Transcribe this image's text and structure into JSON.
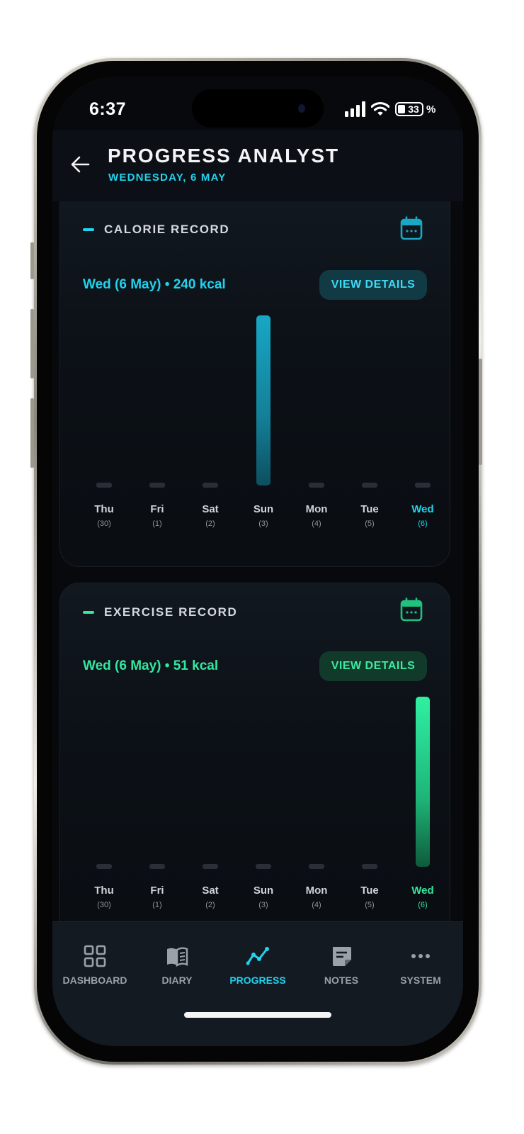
{
  "status": {
    "time": "6:37",
    "battery": "33",
    "battery_pct": "%"
  },
  "header": {
    "title": "PROGRESS ANALYST",
    "subtitle": "WEDNESDAY, 6 MAY"
  },
  "colors": {
    "cyan": "#22d3ee",
    "green": "#34e89e",
    "background": "#07090d"
  },
  "calorie": {
    "title": "CALORIE RECORD",
    "summary": "Wed (6 May) • 240 kcal",
    "button": "VIEW DETAILS",
    "icon": "calendar-icon"
  },
  "exercise": {
    "title": "EXERCISE RECORD",
    "summary": "Wed (6 May) • 51 kcal",
    "button": "VIEW DETAILS",
    "icon": "calendar-icon"
  },
  "chart_data": [
    {
      "type": "bar",
      "title": "CALORIE RECORD",
      "categories": [
        "Thu",
        "Fri",
        "Sat",
        "Sun",
        "Mon",
        "Tue",
        "Wed"
      ],
      "category_dates": [
        "(30)",
        "(1)",
        "(2)",
        "(3)",
        "(4)",
        "(5)",
        "(6)"
      ],
      "values": [
        0,
        0,
        0,
        1,
        0,
        0,
        0
      ],
      "highlight": "Wed",
      "color": "#1aa7c4"
    },
    {
      "type": "bar",
      "title": "EXERCISE RECORD",
      "categories": [
        "Thu",
        "Fri",
        "Sat",
        "Sun",
        "Mon",
        "Tue",
        "Wed"
      ],
      "category_dates": [
        "(30)",
        "(1)",
        "(2)",
        "(3)",
        "(4)",
        "(5)",
        "(6)"
      ],
      "values": [
        0,
        0,
        0,
        0,
        0,
        0,
        1
      ],
      "highlight": "Wed",
      "color": "#34e89e"
    }
  ],
  "nav": {
    "items": [
      {
        "label": "DASHBOARD",
        "icon": "grid-icon",
        "active": false
      },
      {
        "label": "DIARY",
        "icon": "book-icon",
        "active": false
      },
      {
        "label": "PROGRESS",
        "icon": "trend-icon",
        "active": true
      },
      {
        "label": "NOTES",
        "icon": "note-icon",
        "active": false
      },
      {
        "label": "SYSTEM",
        "icon": "more-icon",
        "active": false
      }
    ]
  }
}
